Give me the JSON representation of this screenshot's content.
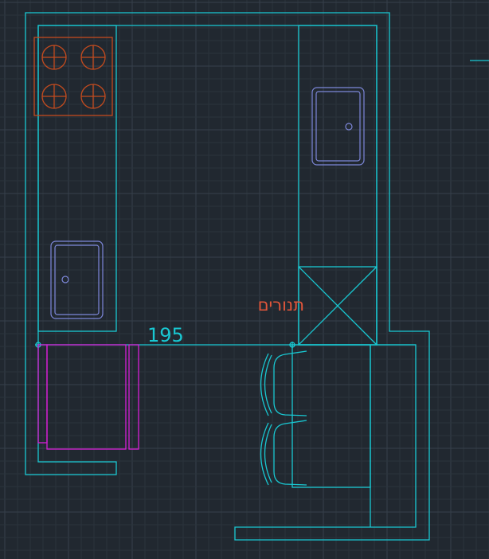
{
  "dimension": {
    "value": "195"
  },
  "labels": {
    "oven": "תנורים"
  },
  "colors": {
    "background": "#212830",
    "grid_minor": "#2b333c",
    "grid_major": "#36404b",
    "walls": "#19c8d2",
    "table": "#d61fd6",
    "sinks": "#7d87d9",
    "stove": "#c44b1e",
    "oven_text": "#e2563a"
  }
}
